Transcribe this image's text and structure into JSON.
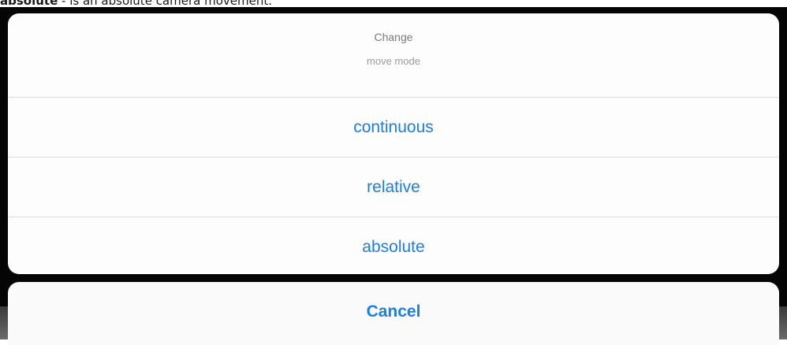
{
  "caption": {
    "bold_part": "absolute",
    "rest": " - is an absolute camera movement."
  },
  "action_sheet": {
    "title": "Change",
    "message": "move mode",
    "actions": [
      {
        "label": "continuous"
      },
      {
        "label": "relative"
      },
      {
        "label": "absolute"
      }
    ],
    "cancel_label": "Cancel"
  },
  "colors": {
    "accent": "#1a7fe6",
    "sheet_background": "#fdfdfd",
    "screen_background": "#050505"
  }
}
